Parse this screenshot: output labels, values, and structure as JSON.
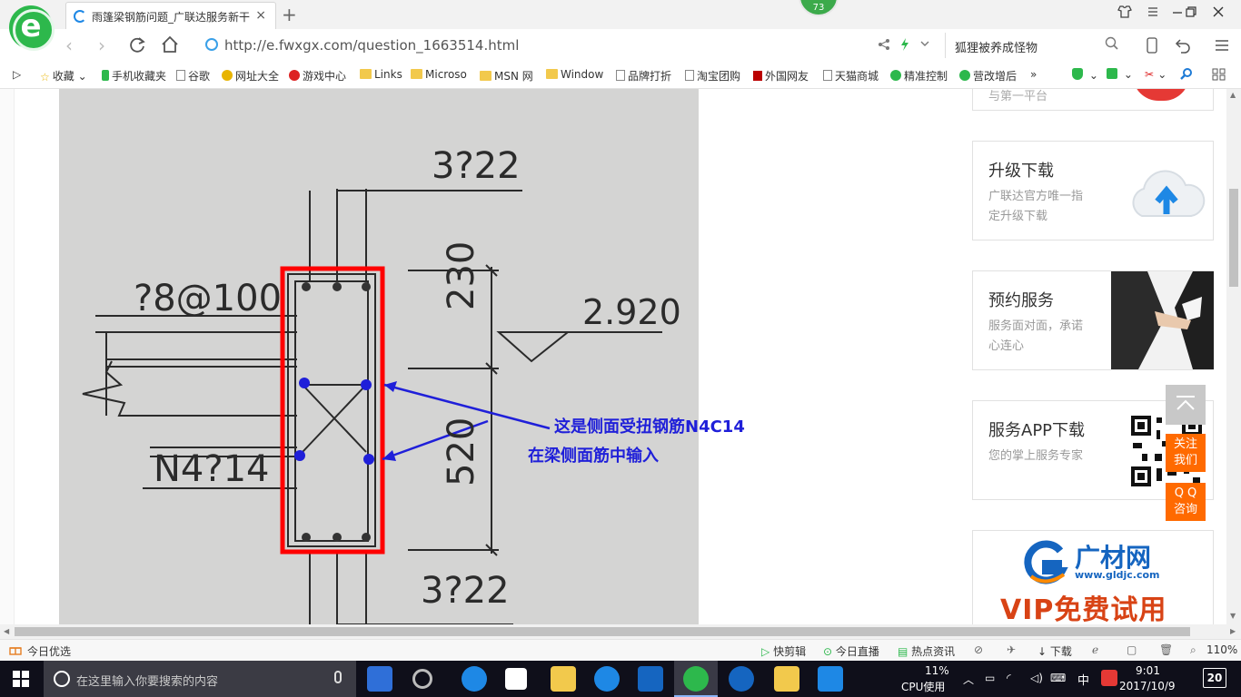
{
  "browser": {
    "tab_title": "雨篷梁钢筋问题_广联达服务新干",
    "tab_close": "×",
    "new_tab": "+",
    "badge_count": "73",
    "url": "http://e.fwxgx.com/question_1663514.html",
    "search_text": "狐狸被养成怪物"
  },
  "bookmarks": [
    {
      "label": "收藏",
      "icon": "star-icon"
    },
    {
      "label": "手机收藏夹",
      "icon": "phone-icon"
    },
    {
      "label": "谷歌",
      "icon": "page-icon"
    },
    {
      "label": "网址大全",
      "icon": "globe-icon"
    },
    {
      "label": "游戏中心",
      "icon": "game-icon"
    },
    {
      "label": "Links",
      "icon": "folder-icon"
    },
    {
      "label": "Microso",
      "icon": "folder-icon"
    },
    {
      "label": "MSN 网",
      "icon": "folder-icon"
    },
    {
      "label": "Window",
      "icon": "folder-icon"
    },
    {
      "label": "品牌打折",
      "icon": "page-icon"
    },
    {
      "label": "淘宝团购",
      "icon": "page-icon"
    },
    {
      "label": "外国网友",
      "icon": "flag-icon"
    },
    {
      "label": "天猫商城",
      "icon": "page-icon"
    },
    {
      "label": "精准控制",
      "icon": "wechat-icon"
    },
    {
      "label": "营改增后",
      "icon": "wechat-icon"
    }
  ],
  "drawing": {
    "top_rebar": "3?22",
    "stirrup": "?8@100",
    "dim_upper": "230",
    "elevation": "2.920",
    "side_rebar": "N4?14",
    "dim_lower": "520",
    "bottom_rebar": "3?22",
    "annotation_line1": "这是侧面受扭钢筋N4C14",
    "annotation_line2": "在梁侧面筋中输入"
  },
  "sidebar": {
    "top_partial_text": "与第一平台",
    "cards": [
      {
        "title": "升级下载",
        "desc": "广联达官方唯一指定升级下载"
      },
      {
        "title": "预约服务",
        "desc": "服务面对面，承诺心连心"
      },
      {
        "title": "服务APP下载",
        "desc": "您的掌上服务专家"
      }
    ],
    "ad_brand": "广材网",
    "ad_site": "www.gldjc.com",
    "ad_slogan": "VIP免费试用"
  },
  "float_buttons": {
    "follow": "关注\n我们",
    "qq": "Q Q\n咨询"
  },
  "statusbar": {
    "left": "今日优选",
    "items": [
      "快剪辑",
      "今日直播",
      "热点资讯"
    ],
    "download": "下载",
    "zoom": "110%"
  },
  "taskbar": {
    "search_placeholder": "在这里输入你要搜索的内容",
    "cpu_percent": "11%",
    "cpu_label": "CPU使用",
    "ime": "中",
    "time": "9:01",
    "date": "2017/10/9",
    "notifications": "20"
  },
  "colors": {
    "annotation_blue": "#1f1fd9",
    "highlight_red": "#ff0000",
    "brand_green": "#2db84c",
    "float_orange": "#ff6a00"
  }
}
